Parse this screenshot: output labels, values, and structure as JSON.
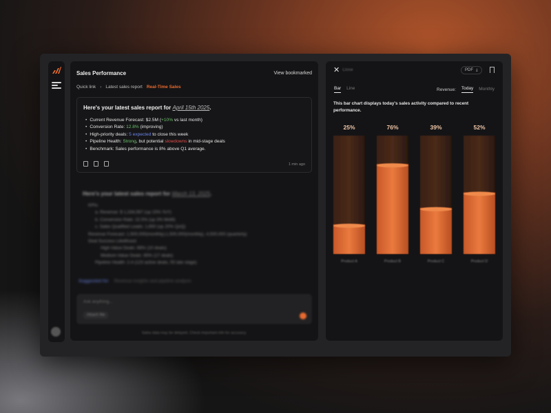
{
  "sidebar": {
    "menu": "menu-icon"
  },
  "left": {
    "title": "Sales Performance",
    "bookmark": "View bookmarked",
    "crumbs": [
      "Quick link",
      "Latest sales report",
      "Real-Time Sales"
    ],
    "card": {
      "title_prefix": "Here's your latest sales report for ",
      "title_date": "April 15th 2025",
      "title_suffix": ".",
      "b1_a": "Current Revenue Forecast: $2.5M (",
      "b1_b": "+10%",
      "b1_c": " vs last month)",
      "b2_a": "Conversion Rate: ",
      "b2_b": "12.8%",
      "b2_c": " (improving)",
      "b3_a": "High-priority deals: ",
      "b3_b": "5 expected",
      "b3_c": " to close this week",
      "b4_a": "Pipeline Health: ",
      "b4_b": "Strong",
      "b4_c": ", but potential ",
      "b4_d": "slowdowns",
      "b4_e": " in mid-stage deals",
      "b5": "Benchmark: Sales performance is 8% above Q1 average.",
      "time": "1 min ago"
    },
    "report2": {
      "title_prefix": "Here's your latest sales report for ",
      "title_date": "March 13, 2025",
      "title_suffix": ".",
      "lines": [
        "KPIs:",
        "a. Revenue: $ 1,334,567 (up 15% YoY)",
        "b. Conversion Rate: 22.5% (up 3% MoM)",
        "c. Sales Qualified Leads: 1,650 (up 20% QoQ)",
        "Revenue Forecast: 1,500,000(monthly);1,500,000(monthly), 4,500,000 (quarterly)",
        "Deal Success Likelihood",
        "High-Value Deals: 68% (10 deals)",
        "Medium-Value Deals: 85% (17 deals)",
        "Pipeline Health: 2.4 (123 active deals, 55 late stage)"
      ]
    },
    "suggest": "Suggested for",
    "suggest_more": "Revenue insights and pipeline analysis",
    "input_placeholder": "Ask anything...",
    "attach": "Attach file",
    "footer": "Sales data may be delayed. Check important info for accuracy."
  },
  "right": {
    "close": "Close",
    "pdf": "PDF",
    "pdf_icon": "download-icon",
    "tabs": [
      "Bar",
      "Line"
    ],
    "revenue_label": "Revenue:",
    "periods": [
      "Today",
      "Monthly"
    ],
    "description": "This bar chart displays today's sales activity compared to recent performance."
  },
  "colors": {
    "accent": "#e86a2e",
    "green": "#6cc46a",
    "blue": "#6c86e8",
    "red": "#e0504a"
  },
  "chart_data": {
    "type": "bar",
    "categories": [
      "Product A",
      "Product B",
      "Product C",
      "Product D"
    ],
    "values": [
      25,
      76,
      39,
      52
    ],
    "labels": [
      "25%",
      "76%",
      "39%",
      "52%"
    ],
    "ylim": [
      0,
      100
    ]
  }
}
